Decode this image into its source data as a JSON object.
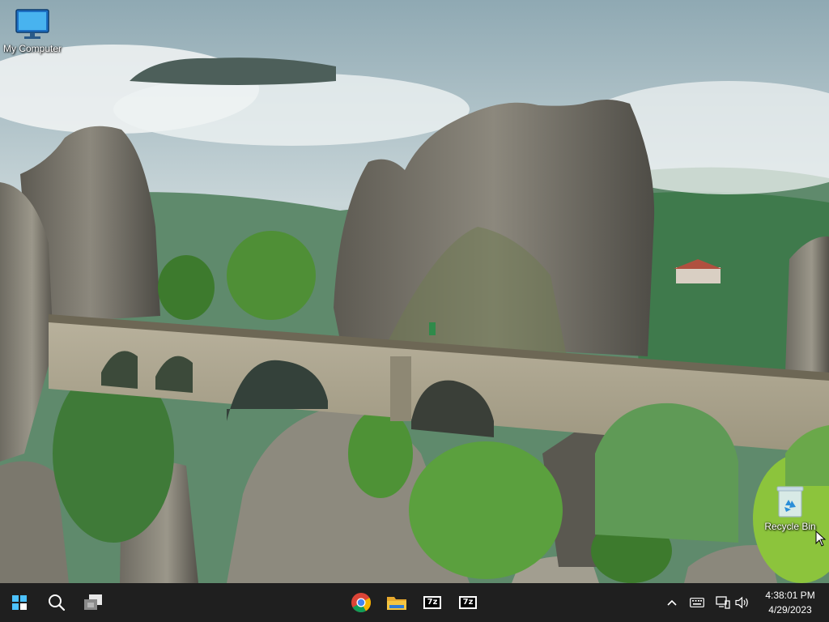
{
  "desktop": {
    "icons": [
      {
        "label": "My Computer",
        "icon": "monitor-icon"
      },
      {
        "label": "Recycle Bin",
        "icon": "recycle-bin-icon"
      }
    ]
  },
  "taskbar": {
    "left": [
      {
        "icon": "windows-start-icon"
      },
      {
        "icon": "search-icon"
      },
      {
        "icon": "task-view-icon"
      }
    ],
    "pinned": [
      {
        "icon": "chrome-icon"
      },
      {
        "icon": "file-explorer-icon"
      },
      {
        "icon": "sevenzip-icon",
        "text": "7z"
      },
      {
        "icon": "sevenzip-icon",
        "text": "7z"
      }
    ],
    "tray": [
      {
        "icon": "chevron-up-icon"
      },
      {
        "icon": "keyboard-icon"
      },
      {
        "icon": "network-icon"
      },
      {
        "icon": "volume-icon"
      }
    ],
    "clock": {
      "time": "4:38:01 PM",
      "date": "4/29/2023"
    }
  },
  "colors": {
    "taskbar_bg": "#1f1f1f",
    "start_blue": "#4cc2ff",
    "folder_yellow": "#f4c542"
  }
}
